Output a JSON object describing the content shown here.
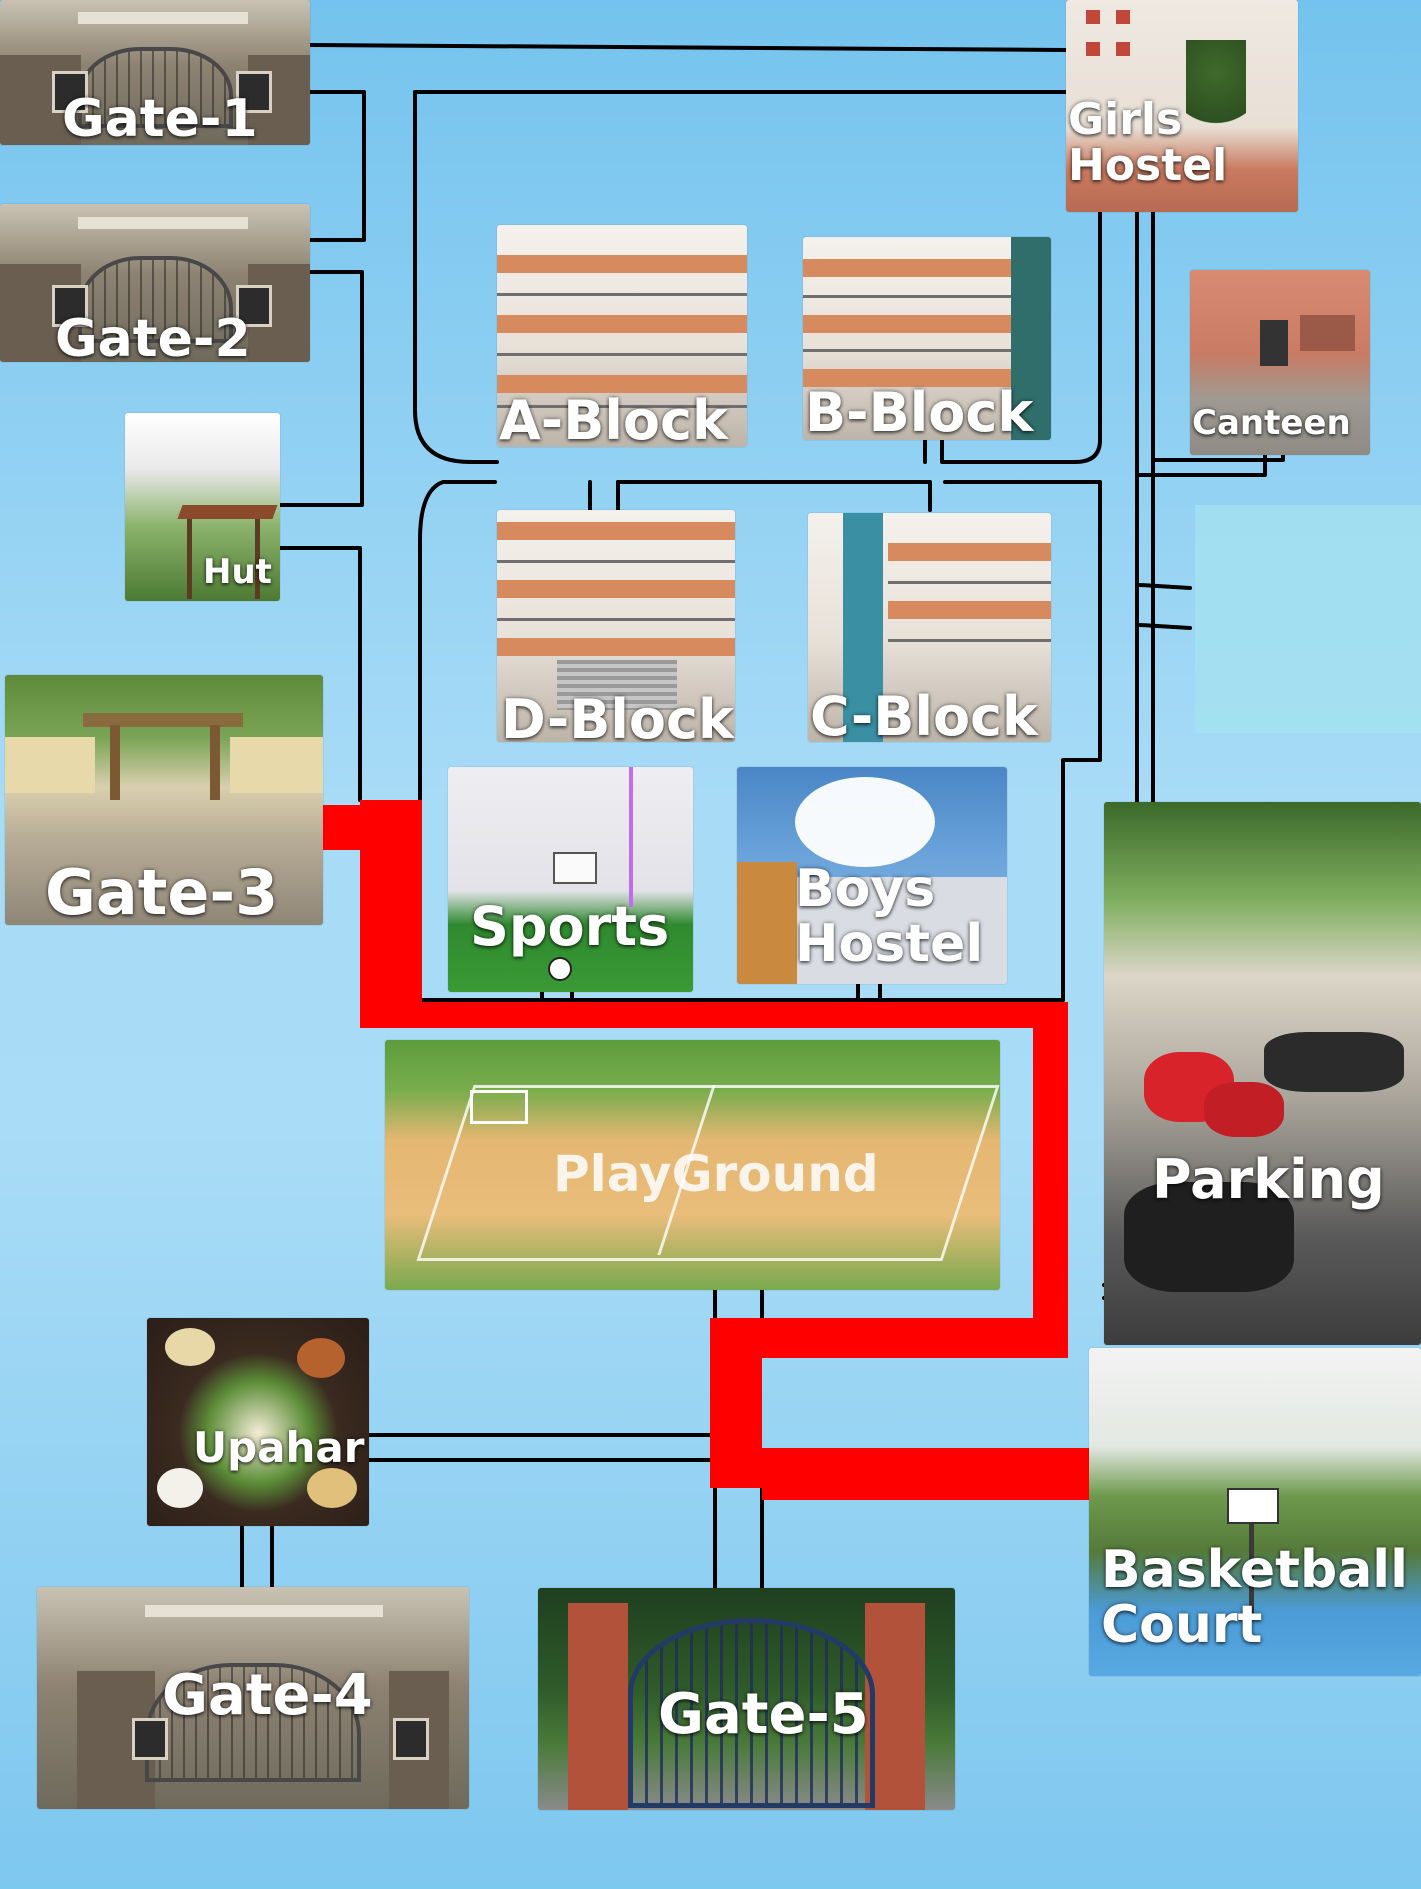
{
  "map": {
    "background": "#8ed0f3",
    "road_color": "#000000",
    "highlight_color": "#ff0000"
  },
  "locations": {
    "gate1": {
      "label": "Gate-1",
      "icon": "gate-photo"
    },
    "gate2": {
      "label": "Gate-2",
      "icon": "gate-photo"
    },
    "hut": {
      "label": "Hut",
      "icon": "hut-photo"
    },
    "gate3": {
      "label": "Gate-3",
      "icon": "gate-photo"
    },
    "girls_hostel": {
      "label": "Girls\nHostel",
      "icon": "hostel-photo"
    },
    "canteen": {
      "label": "Canteen",
      "icon": "canteen-photo"
    },
    "a_block": {
      "label": "A-Block",
      "icon": "building-photo"
    },
    "b_block": {
      "label": "B-Block",
      "icon": "building-photo"
    },
    "d_block": {
      "label": "D-Block",
      "icon": "building-photo"
    },
    "c_block": {
      "label": "C-Block",
      "icon": "building-photo"
    },
    "sports": {
      "label": "Sports",
      "icon": "sports-hall-photo"
    },
    "boys_hostel": {
      "label": "Boys\nHostel",
      "icon": "hostel-photo"
    },
    "playground": {
      "label": "PlayGround",
      "icon": "football-field-photo"
    },
    "parking": {
      "label": "Parking",
      "icon": "parking-photo"
    },
    "upahar": {
      "label": "Upahar",
      "icon": "food-photo"
    },
    "basketball_court": {
      "label": "Basketball\nCourt",
      "icon": "basketball-court-photo"
    },
    "gate4": {
      "label": "Gate-4",
      "icon": "gate-photo"
    },
    "gate5": {
      "label": "Gate-5",
      "icon": "gate-photo"
    }
  }
}
